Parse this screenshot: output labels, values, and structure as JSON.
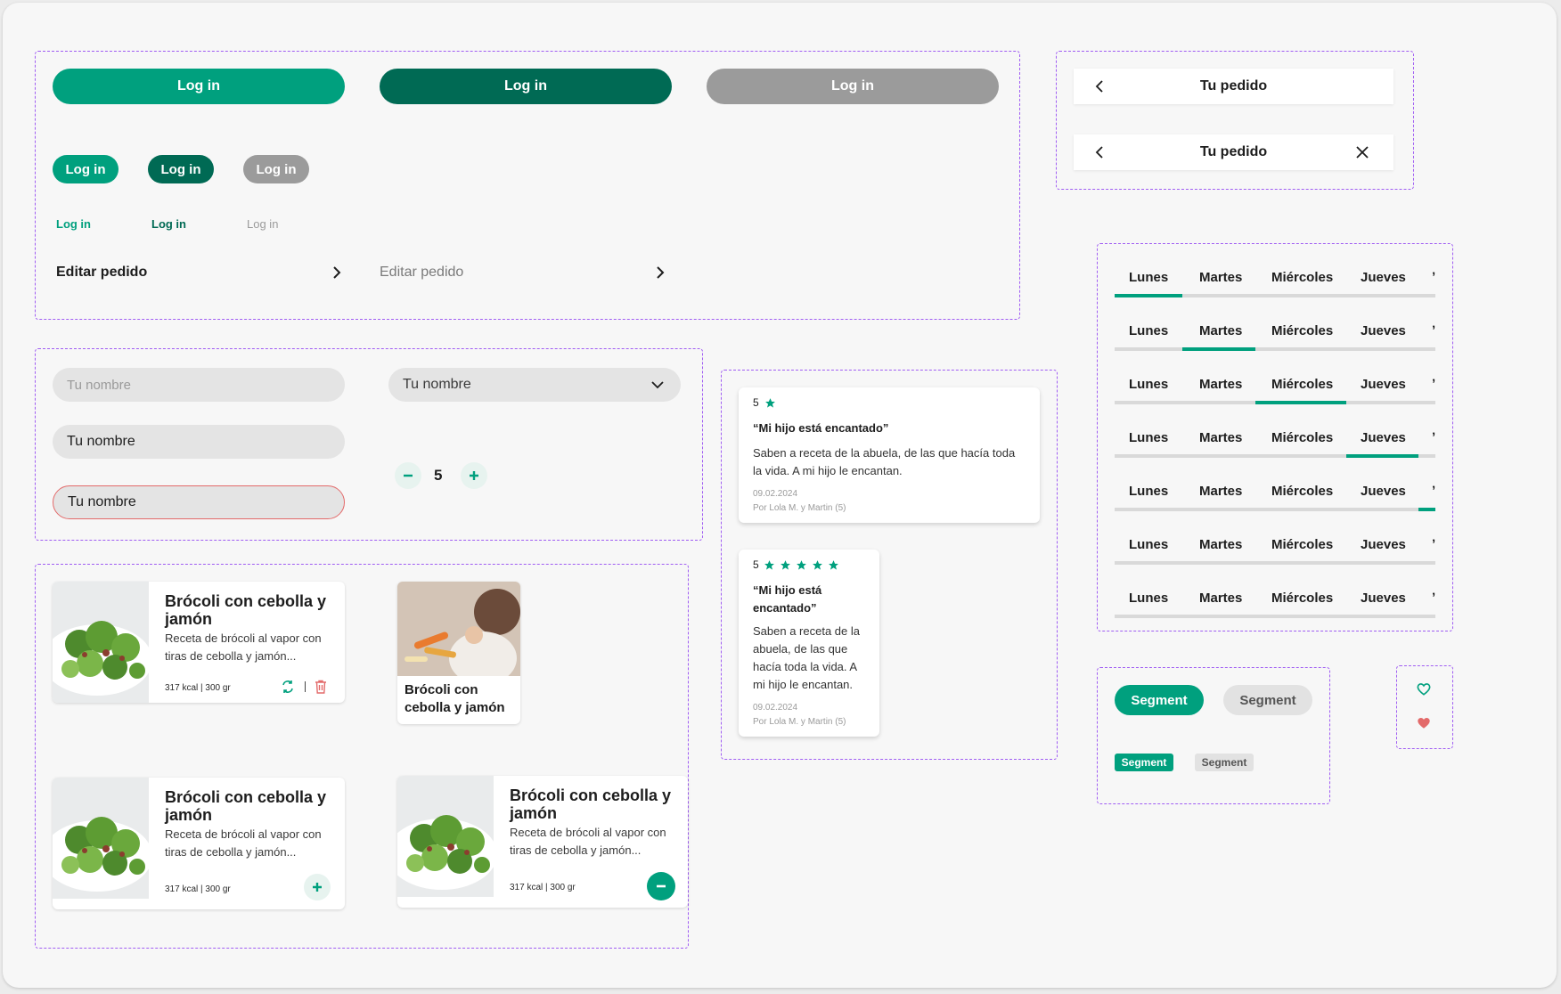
{
  "colors": {
    "primary": "#00a07e",
    "primary_dark": "#006a54",
    "disabled": "#9b9b9b",
    "error": "#e36a6a",
    "group_border": "#a05df3"
  },
  "buttons": {
    "large_primary": "Log in",
    "large_dark": "Log in",
    "large_disabled": "Log in",
    "small_primary": "Log in",
    "small_dark": "Log in",
    "small_disabled": "Log in",
    "link_primary": "Log in",
    "link_dark": "Log in",
    "link_disabled": "Log in"
  },
  "list_links": {
    "active": "Editar pedido",
    "disabled": "Editar pedido"
  },
  "headers": {
    "back": "Tu pedido",
    "back_close": "Tu pedido"
  },
  "inputs": {
    "placeholder": "Tu nombre",
    "filled": "Tu nombre",
    "error": "Tu nombre",
    "select": "Tu nombre"
  },
  "stepper": {
    "value": "5"
  },
  "reviews": [
    {
      "rating": "5",
      "quote": "“Mi hijo está encantado”",
      "text": "Saben a receta de la abuela, de las que hacía toda la vida. A mi hijo le encantan.",
      "date": "09.02.2024",
      "author": "Por Lola M. y Martin (5)"
    },
    {
      "rating": "5",
      "quote": "“Mi hijo está encantado”",
      "text": "Saben a receta de la abuela, de las que hacía toda la vida. A mi hijo le encantan.",
      "date": "09.02.2024",
      "author": "Por Lola M. y Martin (5)"
    }
  ],
  "tabs": {
    "labels": [
      "Lunes",
      "Martes",
      "Miércoles",
      "Jueves"
    ],
    "active_indexes": [
      0,
      1,
      2,
      3,
      4,
      -1,
      -1
    ]
  },
  "recipes": [
    {
      "title": "Brócoli con cebolla y jamón",
      "desc": "Receta de brócoli al vapor con tiras de cebolla y jamón...",
      "meta": "317 kcal | 300 gr"
    },
    {
      "title": "Brócoli con cebolla y jamón",
      "desc": "Receta de brócoli al vapor con tiras de cebolla y jamón...",
      "meta": "317 kcal | 300 gr"
    },
    {
      "title": "Brócoli con cebolla y jamón",
      "desc": "Receta de brócoli al vapor con tiras de cebolla y jamón...",
      "meta": "317 kcal | 300 gr"
    }
  ],
  "mini_card": {
    "title": "Brócoli con cebolla y jamón"
  },
  "segments": {
    "large_active": "Segment",
    "large_inactive": "Segment",
    "small_active": "Segment",
    "small_inactive": "Segment"
  },
  "icons": [
    "chevron-left-icon",
    "chevron-right-icon",
    "close-icon",
    "chevron-down-icon",
    "minus-icon",
    "plus-icon",
    "star-icon",
    "swap-icon",
    "trash-icon",
    "heart-outline-icon",
    "heart-filled-icon"
  ]
}
